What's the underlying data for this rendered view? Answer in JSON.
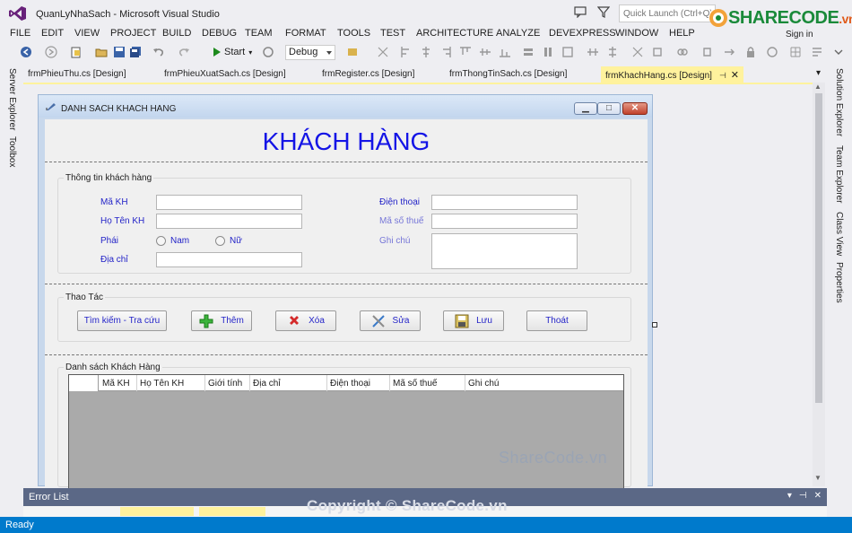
{
  "window": {
    "title": "QuanLyNhaSach - Microsoft Visual Studio"
  },
  "quick_launch": {
    "placeholder": "Quick Launch (Ctrl+Q)"
  },
  "brand": {
    "name": "SHARECODE",
    "domain": ".vn"
  },
  "account": {
    "signin_label": "Sign in"
  },
  "menu": [
    "FILE",
    "EDIT",
    "VIEW",
    "PROJECT",
    "BUILD",
    "DEBUG",
    "TEAM",
    "FORMAT",
    "TOOLS",
    "TEST",
    "ARCHITECTURE",
    "ANALYZE",
    "DEVEXPRESS",
    "WINDOW",
    "HELP"
  ],
  "toolbar": {
    "start_label": "Start",
    "config_value": "Debug"
  },
  "left_panels": [
    "Server Explorer",
    "Toolbox"
  ],
  "right_panels": [
    "Solution Explorer",
    "Team Explorer",
    "Class View",
    "Properties"
  ],
  "doc_tabs": [
    {
      "label": "frmPhieuThu.cs [Design]",
      "active": false
    },
    {
      "label": "frmPhieuXuatSach.cs [Design]",
      "active": false
    },
    {
      "label": "frmRegister.cs [Design]",
      "active": false
    },
    {
      "label": "frmThongTinSach.cs [Design]",
      "active": false
    },
    {
      "label": "frmKhachHang.cs [Design]",
      "active": true
    }
  ],
  "form": {
    "window_title": "DANH SACH KHACH HANG",
    "heading": "KHÁCH HÀNG",
    "info_group": {
      "title": "Thông tin khách hàng",
      "fields": {
        "ma_kh": "Mã KH",
        "ho_ten": "Họ Tên KH",
        "phai": "Phái",
        "dia_chi": "Địa chỉ",
        "dien_thoai": "Điện thoại",
        "ma_so_thue": "Mã số thuế",
        "ghi_chu": "Ghi chú"
      },
      "radio_male": "Nam",
      "radio_female": "Nữ"
    },
    "action_group": {
      "title": "Thao Tác",
      "buttons": {
        "search": "Tìm kiếm - Tra cứu",
        "add": "Thêm",
        "delete": "Xóa",
        "edit": "Sửa",
        "save": "Lưu",
        "exit": "Thoát"
      }
    },
    "list_group": {
      "title": "Danh sách Khách Hàng",
      "columns": [
        "Mã KH",
        "Họ Tên KH",
        "Giới tính",
        "Địa chỉ",
        "Điện thoại",
        "Mã số thuế",
        "Ghi chú"
      ]
    }
  },
  "error_list": {
    "title": "Error List"
  },
  "status": {
    "text": "Ready"
  },
  "watermark": {
    "site": "ShareCode.vn",
    "copyright": "Copyright © ShareCode.vn"
  },
  "colors": {
    "accent": "#007acc",
    "active_tab": "#fff29d",
    "form_heading": "#1414e6",
    "label_text": "#2424c8",
    "panel_header": "#5b6886"
  }
}
